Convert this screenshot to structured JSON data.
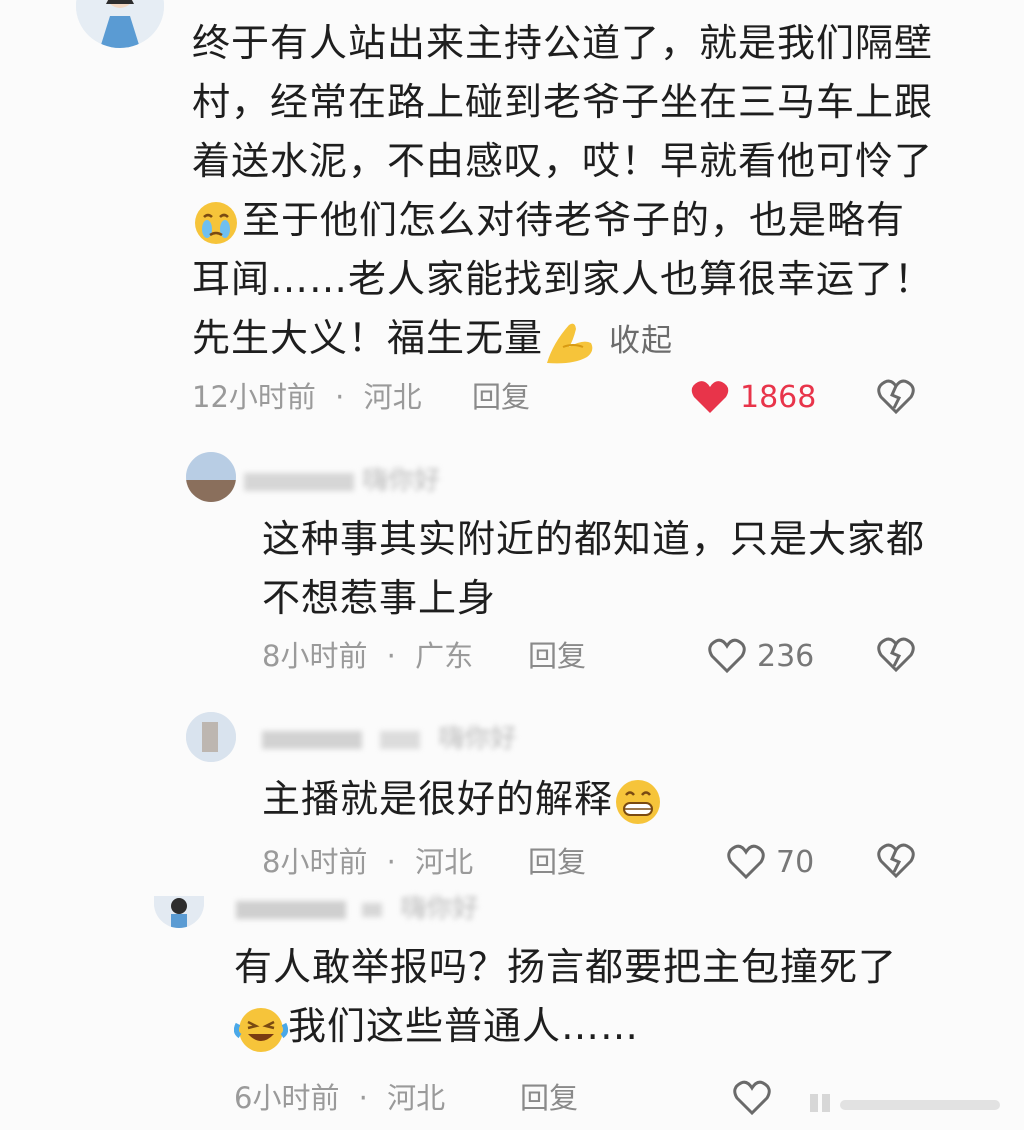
{
  "comments": [
    {
      "author": "",
      "lines": [
        "终于有人站出来主持公道了，就是我们隔壁",
        "村，经常在路上碰到老爷子坐在三马车上跟",
        "着送水泥，不由感叹，哎！早就看他可怜了",
        "至于他们怎么对待老爷子的，也是略有",
        "耳闻……老人家能找到家人也算很幸运了！",
        "先生大义！福生无量"
      ],
      "collapse_label": "收起",
      "time": "12小时前",
      "location": "河北",
      "reply_label": "回复",
      "likes": "1868",
      "liked": true
    },
    {
      "author": "嗨你好",
      "lines": [
        "这种事其实附近的都知道，只是大家都",
        "不想惹事上身"
      ],
      "time": "8小时前",
      "location": "广东",
      "reply_label": "回复",
      "likes": "236",
      "liked": false
    },
    {
      "author": "嗨你好",
      "lines": [
        "主播就是很好的解释"
      ],
      "time": "8小时前",
      "location": "河北",
      "reply_label": "回复",
      "likes": "70",
      "liked": false
    },
    {
      "author": "嗨你好",
      "lines": [
        "有人敢举报吗？扬言都要把主包撞死了",
        "我们这些普通人……"
      ],
      "time": "6小时前",
      "location": "河北",
      "reply_label": "回复",
      "likes": "",
      "liked": false
    }
  ],
  "meta_separator": "·",
  "colors": {
    "liked_red": "#e8344a",
    "text": "#1e1e1e",
    "meta": "#9a9a9a"
  },
  "icons": [
    "heart-icon",
    "broken-heart-icon",
    "crying-emoji-icon",
    "folded-hands-emoji-icon",
    "grin-emoji-icon",
    "laughing-crying-emoji-icon"
  ]
}
